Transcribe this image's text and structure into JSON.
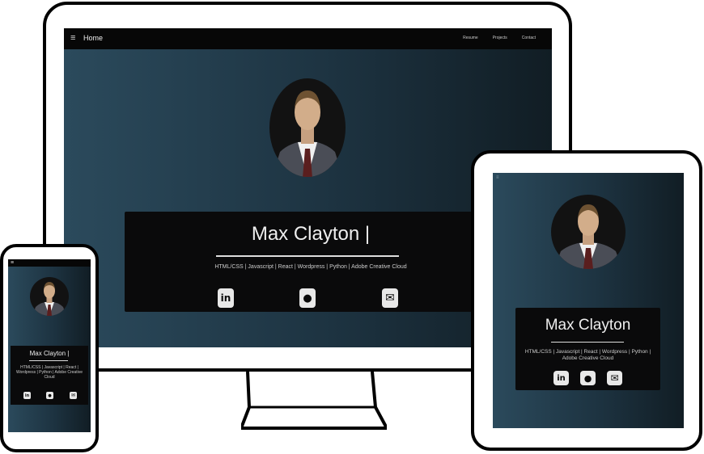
{
  "site": {
    "nav": {
      "home_label": "Home",
      "links": [
        "Resume",
        "Projects",
        "Contact"
      ],
      "menu_icon": "hamburger-icon"
    },
    "profile": {
      "name_desktop": "Max Clayton |",
      "name_tablet": "Max Clayton",
      "name_phone": "Max Clayton  |",
      "skills": "HTML/CSS | Javascript | React | Wordpress | Python | Adobe Creative Cloud",
      "skills_phone": "HTML/CSS | Javascript | React | Wordpress | Python | Adobe Creative Cloud"
    },
    "social": [
      {
        "icon": "linkedin-icon",
        "glyph": "in"
      },
      {
        "icon": "github-icon",
        "glyph": "●"
      },
      {
        "icon": "email-icon",
        "glyph": "✉"
      }
    ],
    "colors": {
      "gradient_left": "#2b4a5c",
      "gradient_right": "#111d24",
      "card_bg": "#0a0a0b",
      "navbar_bg": "#070707",
      "text": "#eeeeee"
    }
  }
}
